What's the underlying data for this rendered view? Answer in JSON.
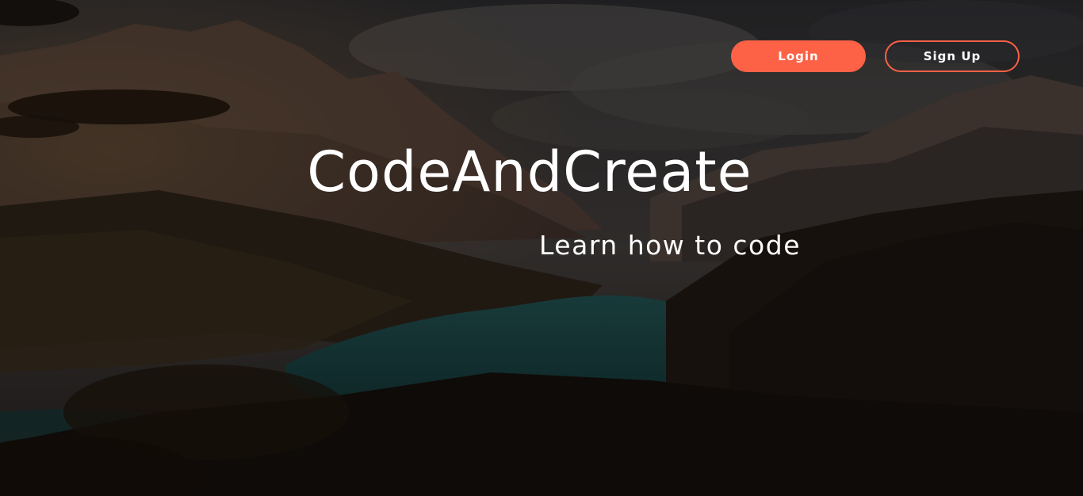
{
  "nav": {
    "login_label": "Login",
    "signup_label": "Sign Up"
  },
  "hero": {
    "title": "CodeAndCreate",
    "subtitle": "Learn how to code"
  },
  "colors": {
    "accent": "#fd6146",
    "text": "#ffffff",
    "overlay": "#000000"
  }
}
